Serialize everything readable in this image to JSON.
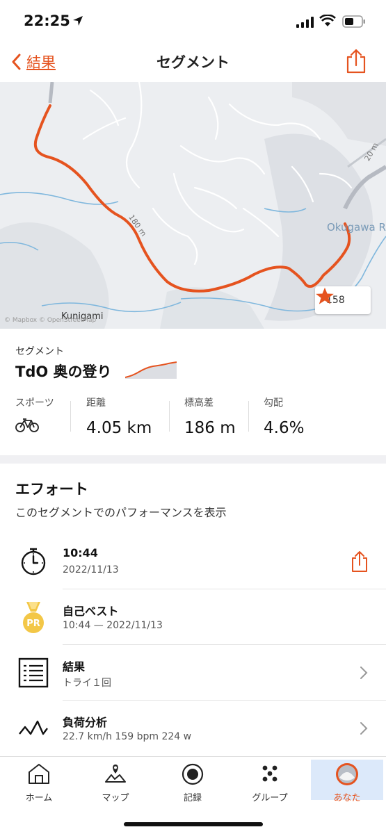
{
  "status": {
    "time": "22:25"
  },
  "nav": {
    "back_label": "結果",
    "title": "セグメント"
  },
  "map": {
    "place_kunigami": "Kunigami",
    "place_okugawa": "Okugawa R",
    "contour_1": "180 m",
    "contour_2": "20 m",
    "copyright": "© Mapbox © OpenStreetMap",
    "star_count": "158"
  },
  "segment": {
    "label": "セグメント",
    "name": "TdO 奥の登り",
    "stats": [
      {
        "label": "スポーツ",
        "value": ""
      },
      {
        "label": "距離",
        "value": "4.05 km"
      },
      {
        "label": "標高差",
        "value": "186 m"
      },
      {
        "label": "勾配",
        "value": "4.6%"
      }
    ]
  },
  "efforts": {
    "heading": "エフォート",
    "subtitle": "このセグメントでのパフォーマンスを表示",
    "rows": [
      {
        "title": "10:44",
        "subtitle": "2022/11/13"
      },
      {
        "title": "自己ベスト",
        "subtitle": "10:44 — 2022/11/13",
        "badge": "PR"
      },
      {
        "title": "結果",
        "subtitle": "トライ１回"
      },
      {
        "title": "負荷分析",
        "subtitle": "22.7 km/h 159 bpm 224 w"
      }
    ]
  },
  "tabs": [
    {
      "label": "ホーム"
    },
    {
      "label": "マップ"
    },
    {
      "label": "記録"
    },
    {
      "label": "グループ"
    },
    {
      "label": "あなた"
    }
  ],
  "colors": {
    "accent": "#e5531f",
    "route": "#e5531f",
    "active_tab": "#dce9fa"
  }
}
